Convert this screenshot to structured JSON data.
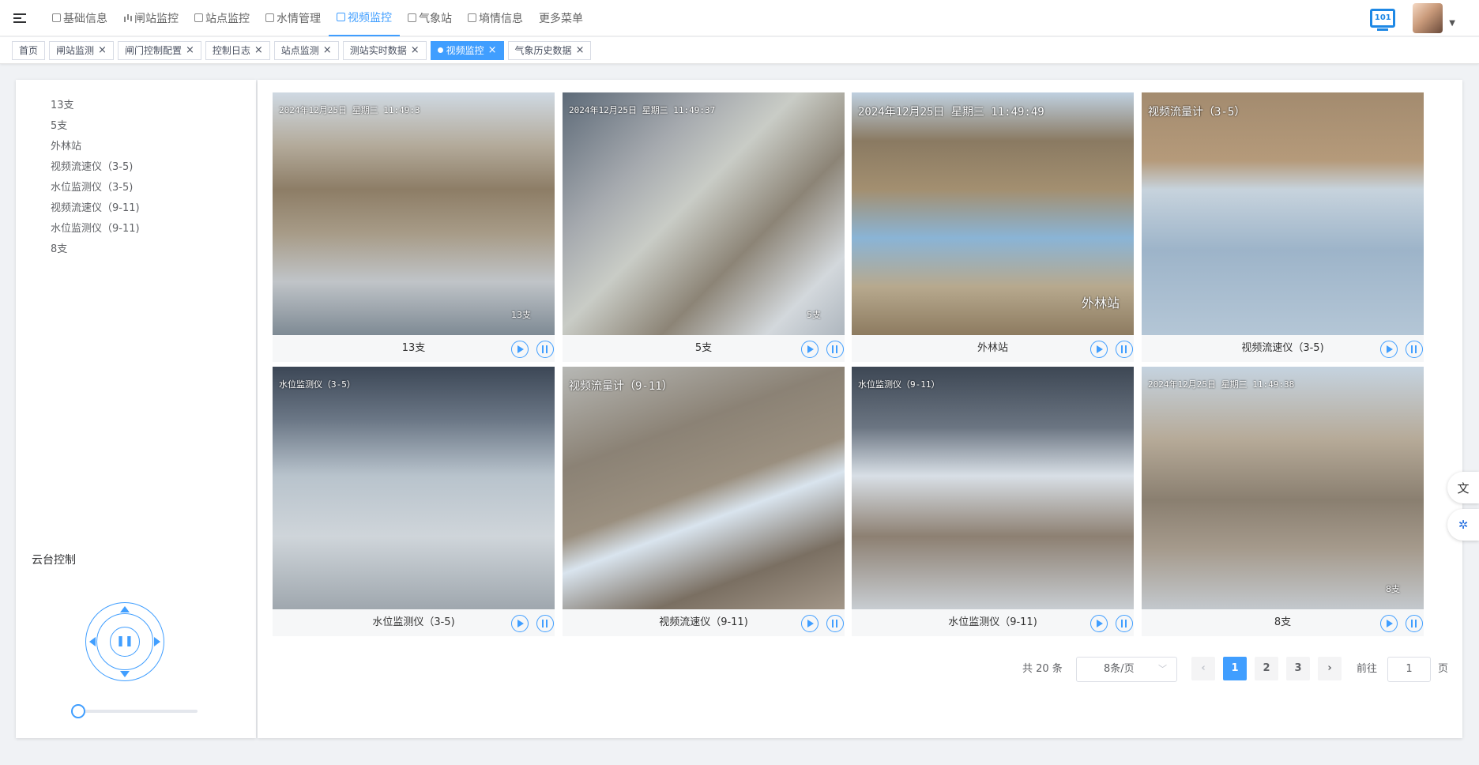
{
  "nav": {
    "items": [
      {
        "label": "基础信息",
        "icon": "doc-icon"
      },
      {
        "label": "闸站监控",
        "icon": "bar-chart-icon"
      },
      {
        "label": "站点监控",
        "icon": "doc-icon"
      },
      {
        "label": "水情管理",
        "icon": "grid-icon"
      },
      {
        "label": "视频监控",
        "icon": "doc-icon",
        "active": true
      },
      {
        "label": "气象站",
        "icon": "calendar-icon"
      },
      {
        "label": "墒情信息",
        "icon": "table-icon"
      },
      {
        "label": "更多菜单",
        "icon": ""
      }
    ],
    "screen_icon_text": "101"
  },
  "tabs": [
    {
      "label": "首页",
      "closable": false
    },
    {
      "label": "闸站监测",
      "closable": true
    },
    {
      "label": "闸门控制配置",
      "closable": true
    },
    {
      "label": "控制日志",
      "closable": true
    },
    {
      "label": "站点监测",
      "closable": true
    },
    {
      "label": "测站实时数据",
      "closable": true
    },
    {
      "label": "视频监控",
      "closable": true,
      "active": true
    },
    {
      "label": "气象历史数据",
      "closable": true
    }
  ],
  "close_glyph": "×",
  "tree": [
    "13支",
    "5支",
    "外林站",
    "视频流速仪（3-5)",
    "水位监测仪（3-5)",
    "视频流速仪（9-11)",
    "水位监测仪（9-11)",
    "8支"
  ],
  "ptz": {
    "title": "云台控制",
    "speed": 0
  },
  "videos": [
    {
      "name": "13支",
      "osd": "2024年12月25日 星期三 11:49:3",
      "corner": "13支"
    },
    {
      "name": "5支",
      "osd": "2024年12月25日 星期三 11:49:37",
      "corner": "5支"
    },
    {
      "name": "外林站",
      "osd": "2024年12月25日 星期三 11:49:49",
      "corner": "外林站"
    },
    {
      "name": "视频流速仪（3-5)",
      "osd": "视频流量计（3-5）",
      "corner": ""
    },
    {
      "name": "水位监测仪（3-5)",
      "osd": "水位监测仪（3-5）",
      "corner": ""
    },
    {
      "name": "视频流速仪（9-11)",
      "osd": "视频流量计（9-11）",
      "corner": ""
    },
    {
      "name": "水位监测仪（9-11)",
      "osd": "水位监测仪（9-11）",
      "corner": ""
    },
    {
      "name": "8支",
      "osd": "2024年12月25日 星期三 11:49:38",
      "corner": "8支"
    }
  ],
  "pager": {
    "total": "共 20 条",
    "page_size": "8条/页",
    "pages": [
      "1",
      "2",
      "3"
    ],
    "current": "1",
    "prev": "‹",
    "next": "›",
    "goto_label": "前往",
    "goto_value": "1",
    "goto_unit": "页"
  },
  "accent": "#409eff"
}
